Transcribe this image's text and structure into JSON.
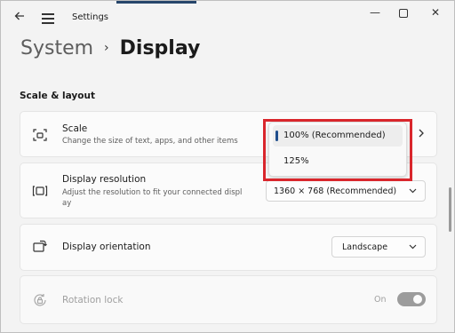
{
  "window": {
    "title": "Settings",
    "controls": {
      "minimize": "—",
      "close": "✕"
    }
  },
  "breadcrumb": {
    "parent": "System",
    "separator": "›",
    "current": "Display"
  },
  "section": {
    "title": "Scale & layout"
  },
  "scale": {
    "title": "Scale",
    "description": "Change the size of text, apps, and other items",
    "options": [
      "100% (Recommended)",
      "125%"
    ],
    "selected": "100% (Recommended)"
  },
  "resolution": {
    "title": "Display resolution",
    "description_line1": "Adjust the resolution to fit your connected displ",
    "description_line2": "ay",
    "value": "1360 × 768 (Recommended)"
  },
  "orientation": {
    "title": "Display orientation",
    "value": "Landscape"
  },
  "rotation_lock": {
    "title": "Rotation lock",
    "state_label": "On",
    "enabled": false,
    "on": true
  },
  "colors": {
    "accent": "#1f4e8c",
    "highlight_box": "#d9262c",
    "background": "#f3f3f3"
  },
  "icons": {
    "back": "back-arrow-icon",
    "menu": "hamburger-menu-icon",
    "scale": "scale-icon",
    "resolution": "resolution-icon",
    "orientation": "orientation-icon",
    "rotation_lock": "rotation-lock-icon"
  }
}
